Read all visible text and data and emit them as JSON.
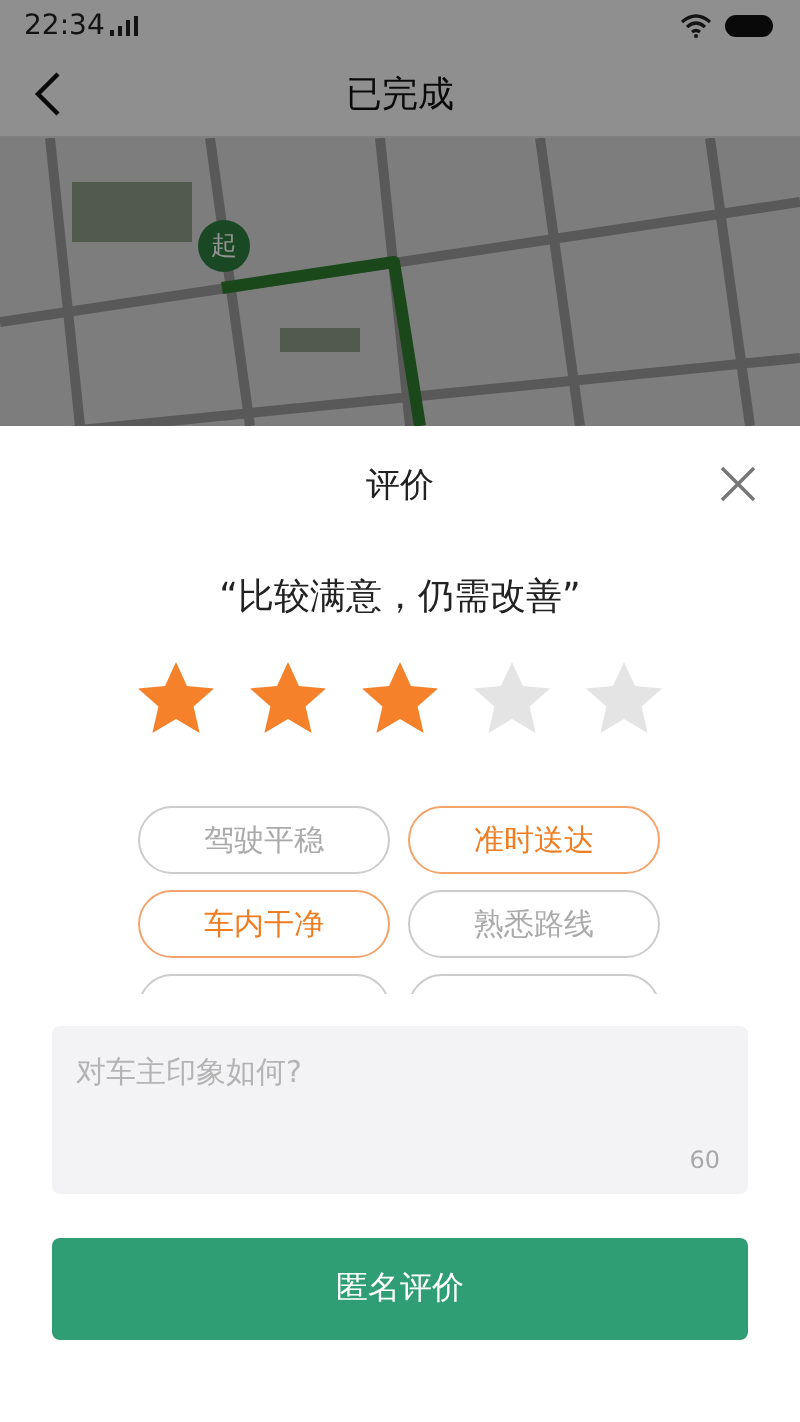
{
  "status_bar": {
    "time": "22:34"
  },
  "header": {
    "title": "已完成"
  },
  "map": {
    "start_marker": "起"
  },
  "rating_sheet": {
    "title": "评价",
    "verdict": "“比较满意，仍需改善”",
    "stars": 3,
    "tags": [
      {
        "label": "驾驶平稳",
        "selected": false
      },
      {
        "label": "准时送达",
        "selected": true
      },
      {
        "label": "车内干净",
        "selected": true
      },
      {
        "label": "熟悉路线",
        "selected": false
      }
    ],
    "comment": {
      "placeholder": "对车主印象如何?",
      "counter": "60"
    },
    "submit_button": "匿名评价"
  }
}
